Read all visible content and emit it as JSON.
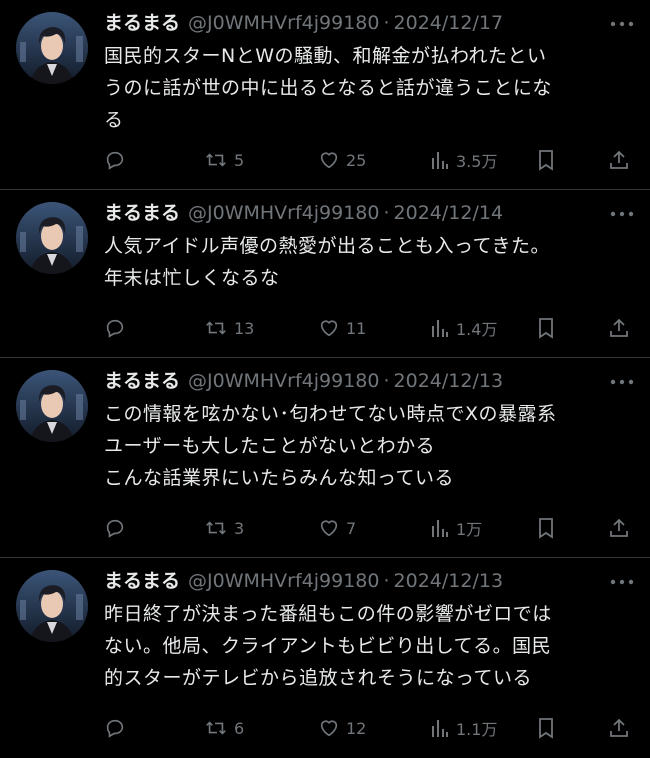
{
  "tweets": [
    {
      "name": "まるまる",
      "handle": "@J0WMHVrf4j99180",
      "separator": "·",
      "date": "2024/12/17",
      "lines": [
        "国民的スターNとWの騒動、和解金が払われたとい",
        "うのに話が世の中に出るとなると話が違うことにな",
        "る"
      ],
      "replies": "",
      "retweets": "5",
      "likes": "25",
      "views": "3.5万"
    },
    {
      "name": "まるまる",
      "handle": "@J0WMHVrf4j99180",
      "separator": "·",
      "date": "2024/12/14",
      "lines": [
        "人気アイドル声優の熱愛が出ることも入ってきた。",
        "年末は忙しくなるな"
      ],
      "replies": "",
      "retweets": "13",
      "likes": "11",
      "views": "1.4万"
    },
    {
      "name": "まるまる",
      "handle": "@J0WMHVrf4j99180",
      "separator": "·",
      "date": "2024/12/13",
      "lines": [
        "この情報を呟かない･匂わせてない時点でXの暴露系",
        "ユーザーも大したことがないとわかる",
        "こんな話業界にいたらみんな知っている"
      ],
      "replies": "",
      "retweets": "3",
      "likes": "7",
      "views": "1万"
    },
    {
      "name": "まるまる",
      "handle": "@J0WMHVrf4j99180",
      "separator": "·",
      "date": "2024/12/13",
      "lines": [
        "昨日終了が決まった番組もこの件の影響がゼロでは",
        "ない。他局、クライアントもビビり出してる。国民",
        "的スターがテレビから追放されそうになっている"
      ],
      "replies": "",
      "retweets": "6",
      "likes": "12",
      "views": "1.1万"
    }
  ],
  "icons": {
    "reply": "reply-icon",
    "retweet": "retweet-icon",
    "like": "heart-icon",
    "views": "views-icon",
    "bookmark": "bookmark-icon",
    "share": "share-icon",
    "more": "more-icon"
  },
  "colors": {
    "background": "#000000",
    "text": "#e7e9ea",
    "muted": "#71767b",
    "divider": "#2f3336"
  }
}
